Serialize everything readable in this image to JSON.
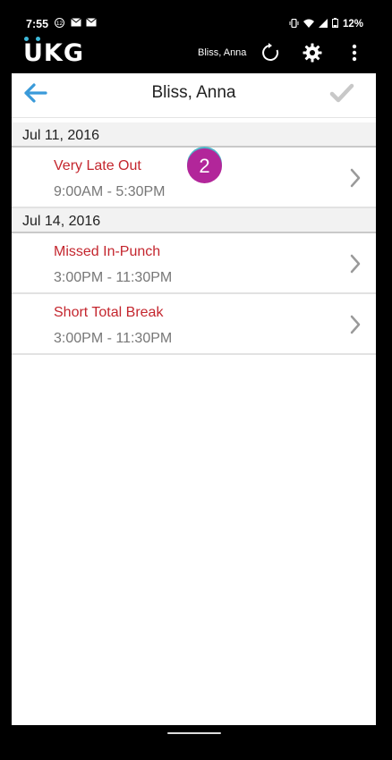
{
  "status_bar": {
    "time": "7:55",
    "notification_count": "12",
    "battery": "12%"
  },
  "header": {
    "logo_text": "UKG",
    "user_name": "Bliss, Anna",
    "icons": [
      "refresh-icon",
      "gear-icon",
      "more-vert-icon"
    ]
  },
  "title_bar": {
    "title": "Bliss, Anna",
    "back_icon": "arrow-left-icon",
    "confirm_icon": "check-icon"
  },
  "groups": [
    {
      "date": "Jul 11, 2016",
      "items": [
        {
          "label": "Very Late Out",
          "time": "9:00AM - 5:30PM"
        }
      ]
    },
    {
      "date": "Jul 14, 2016",
      "items": [
        {
          "label": "Missed In-Punch",
          "time": "3:00PM - 11:30PM"
        },
        {
          "label": "Short Total Break",
          "time": "3:00PM - 11:30PM"
        }
      ]
    }
  ],
  "step_badge": "2",
  "colors": {
    "accent_blue": "#3a9ad9",
    "exception_red": "#c4262e",
    "badge_purple": "#b2269a",
    "logo_dot": "#3db9d9"
  }
}
